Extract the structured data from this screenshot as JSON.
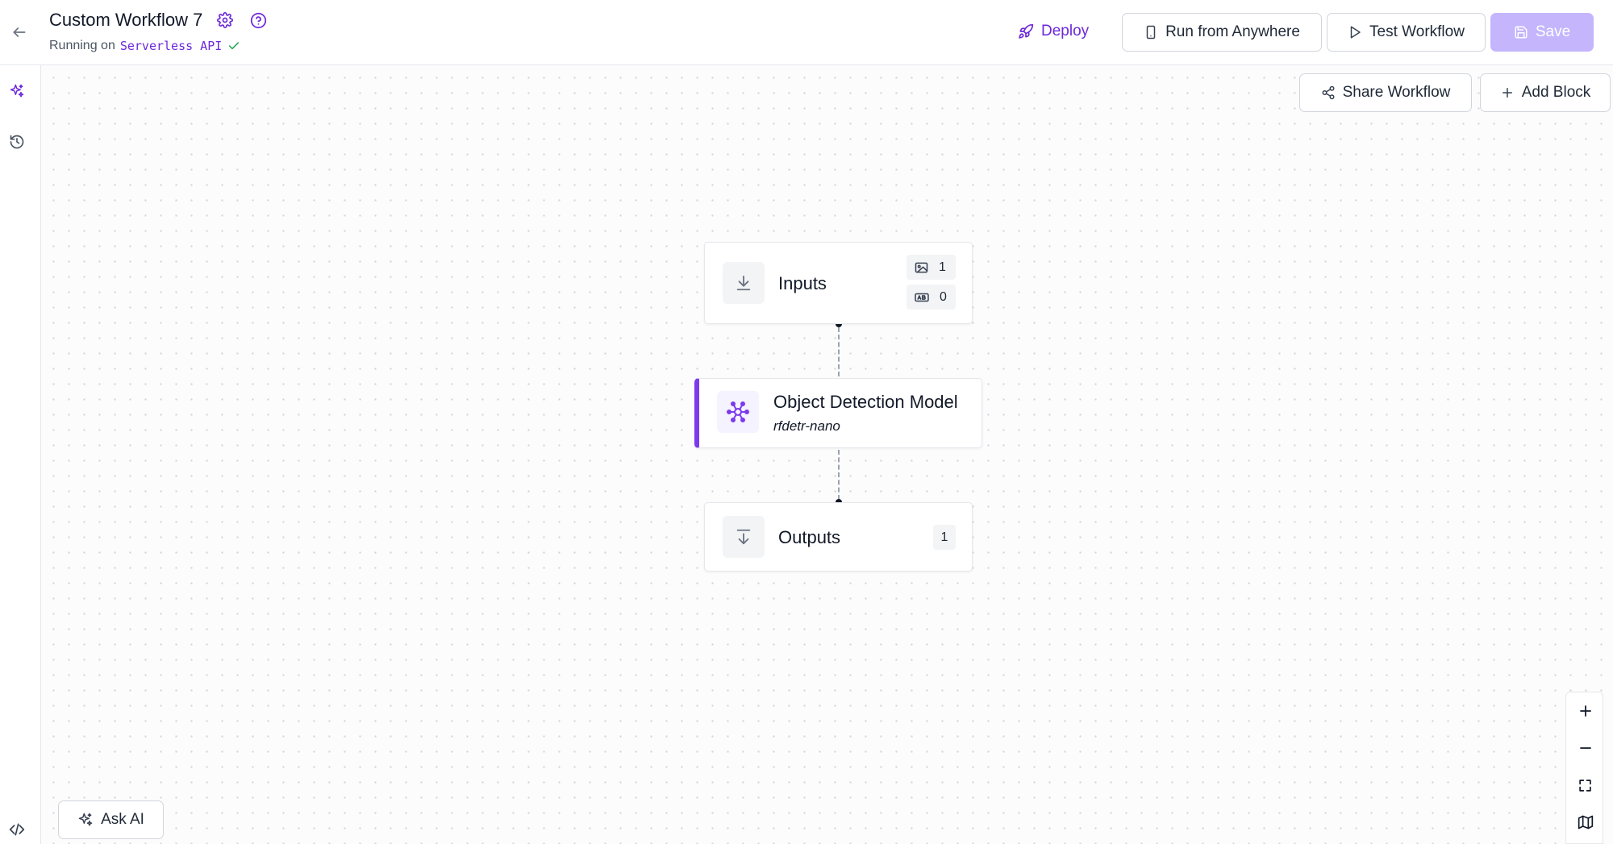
{
  "header": {
    "workflow_title": "Custom Workflow 7",
    "running_prefix": "Running on",
    "running_target": "Serverless API",
    "deploy_label": "Deploy",
    "run_label": "Run from Anywhere",
    "test_label": "Test Workflow",
    "save_label": "Save"
  },
  "canvas_toolbar": {
    "share_label": "Share Workflow",
    "add_block_label": "Add Block"
  },
  "nodes": {
    "inputs": {
      "title": "Inputs",
      "image_count": "1",
      "param_count": "0"
    },
    "model": {
      "title": "Object Detection Model",
      "subtitle": "rfdetr-nano"
    },
    "outputs": {
      "title": "Outputs",
      "count": "1"
    }
  },
  "assistant": {
    "ask_ai_label": "Ask AI"
  },
  "icons": {
    "back": "arrow-left-icon",
    "settings": "gear-icon",
    "help": "question-circle-icon",
    "deploy": "rocket-icon",
    "run": "phone-icon",
    "test": "play-icon",
    "save": "floppy-icon",
    "share": "share-icon",
    "add": "plus-icon",
    "ai": "sparkles-icon",
    "history": "history-icon",
    "code": "code-icon",
    "zoom_in": "plus-icon",
    "zoom_out": "minus-icon",
    "fit": "fit-view-icon",
    "map": "map-icon"
  },
  "colors": {
    "accent": "#6d28d9",
    "accent_bar": "#7c3aed",
    "save_disabled": "#c4b5fd"
  }
}
